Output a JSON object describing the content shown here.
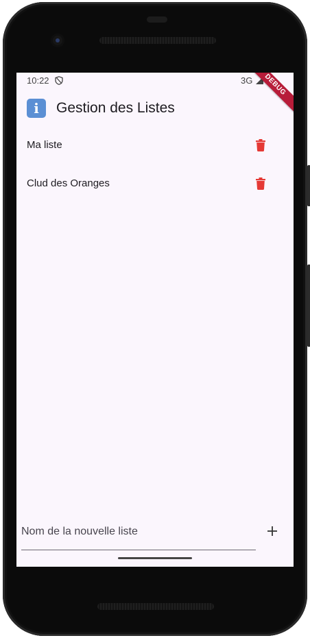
{
  "status_bar": {
    "time": "10:22",
    "network": "3G",
    "debug_label": "DEBUG"
  },
  "app_bar": {
    "icon": "info-icon",
    "icon_glyph": "i",
    "title": "Gestion des Listes"
  },
  "lists": [
    {
      "label": "Ma liste"
    },
    {
      "label": "Clud des Oranges"
    }
  ],
  "new_list": {
    "placeholder": "Nom de la nouvelle liste",
    "value": ""
  },
  "colors": {
    "background": "#fbf6fd",
    "delete": "#e53935",
    "info_icon": "#5b8fd4",
    "debug_banner": "#b71c39"
  }
}
